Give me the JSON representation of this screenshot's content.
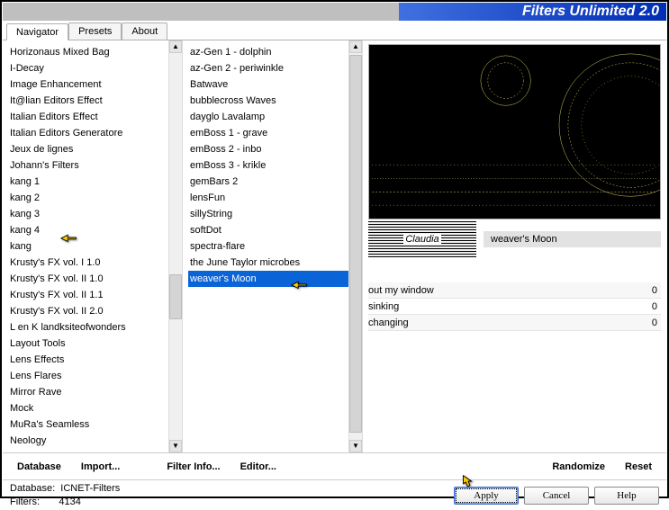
{
  "app": {
    "title": "Filters Unlimited 2.0"
  },
  "tabs": {
    "t0": "Navigator",
    "t1": "Presets",
    "t2": "About"
  },
  "col1": {
    "items": [
      "Horizonaus Mixed Bag",
      "I-Decay",
      "Image Enhancement",
      "It@lian Editors Effect",
      "Italian Editors Effect",
      "Italian Editors Generatore",
      "Jeux de lignes",
      "Johann's Filters",
      "kang 1",
      "kang 2",
      "kang 3",
      "kang 4",
      "kang",
      "Krusty's FX vol. I 1.0",
      "Krusty's FX vol. II 1.0",
      "Krusty's FX vol. II 1.1",
      "Krusty's FX vol. II 2.0",
      "L en K landksiteofwonders",
      "Layout Tools",
      "Lens Effects",
      "Lens Flares",
      "Mirror Rave",
      "Mock",
      "MuRa's Seamless",
      "Neology"
    ]
  },
  "col2": {
    "items": [
      "az-Gen 1  -  dolphin",
      "az-Gen 2  -  periwinkle",
      "Batwave",
      "bubblecross Waves",
      "dayglo Lavalamp",
      "emBoss 1  -  grave",
      "emBoss 2  -  inbo",
      "emBoss 3  -  krikle",
      "gemBars 2",
      "lensFun",
      "sillyString",
      "softDot",
      "spectra-flare",
      "the June Taylor microbes",
      "weaver's Moon"
    ],
    "selected_index": 14
  },
  "right": {
    "filter_name": "weaver's Moon",
    "params": [
      {
        "name": "out my window",
        "value": "0"
      },
      {
        "name": "sinking",
        "value": "0"
      },
      {
        "name": "changing",
        "value": "0"
      }
    ],
    "logo_text": "Claudia"
  },
  "toolbar": {
    "database": "Database",
    "import": "Import...",
    "filterinfo": "Filter Info...",
    "editor": "Editor...",
    "randomize": "Randomize",
    "reset": "Reset"
  },
  "footer": {
    "db_label": "Database:",
    "db_value": "ICNET-Filters",
    "filters_label": "Filters:",
    "filters_value": "4134",
    "apply": "Apply",
    "cancel": "Cancel",
    "help": "Help"
  },
  "glyphs": {
    "up": "▲",
    "down": "▼"
  }
}
